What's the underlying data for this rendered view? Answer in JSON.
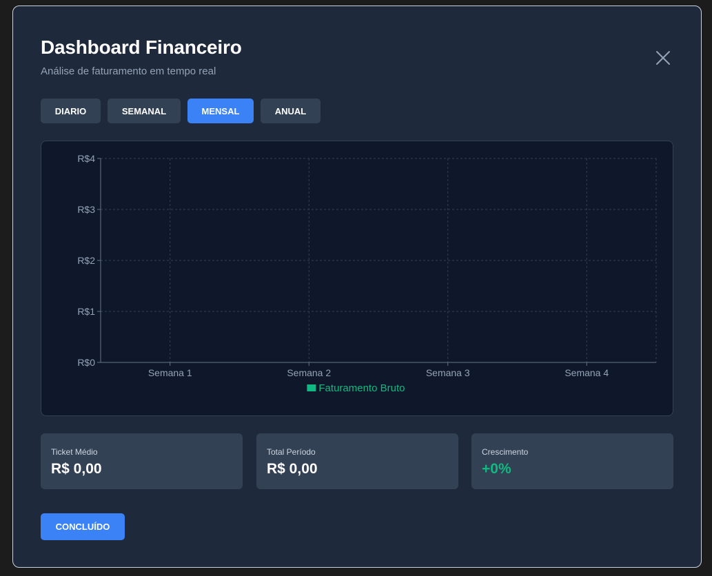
{
  "modal": {
    "title": "Dashboard Financeiro",
    "subtitle": "Análise de faturamento em tempo real",
    "close_icon": "close-icon"
  },
  "tabs": [
    {
      "label": "DIARIO",
      "active": false
    },
    {
      "label": "SEMANAL",
      "active": false
    },
    {
      "label": "MENSAL",
      "active": true
    },
    {
      "label": "ANUAL",
      "active": false
    }
  ],
  "chart_data": {
    "type": "bar",
    "categories": [
      "Semana 1",
      "Semana 2",
      "Semana 3",
      "Semana 4"
    ],
    "series": [
      {
        "name": "Faturamento Bruto",
        "values": [
          0,
          0,
          0,
          0
        ],
        "color": "#10b981"
      }
    ],
    "ylim": [
      0,
      4
    ],
    "yticks": [
      "R$0",
      "R$1",
      "R$2",
      "R$3",
      "R$4"
    ],
    "grid": true,
    "legend_position": "bottom"
  },
  "stats": [
    {
      "label": "Ticket Médio",
      "value": "R$ 0,00",
      "accent": false
    },
    {
      "label": "Total Período",
      "value": "R$ 0,00",
      "accent": false
    },
    {
      "label": "Crescimento",
      "value": "+0%",
      "accent": true
    }
  ],
  "footer": {
    "done_label": "CONCLUÍDO"
  },
  "colors": {
    "modal_bg": "#1e293b",
    "chart_bg": "#0f172a",
    "accent": "#3b82f6",
    "positive": "#10b981"
  }
}
